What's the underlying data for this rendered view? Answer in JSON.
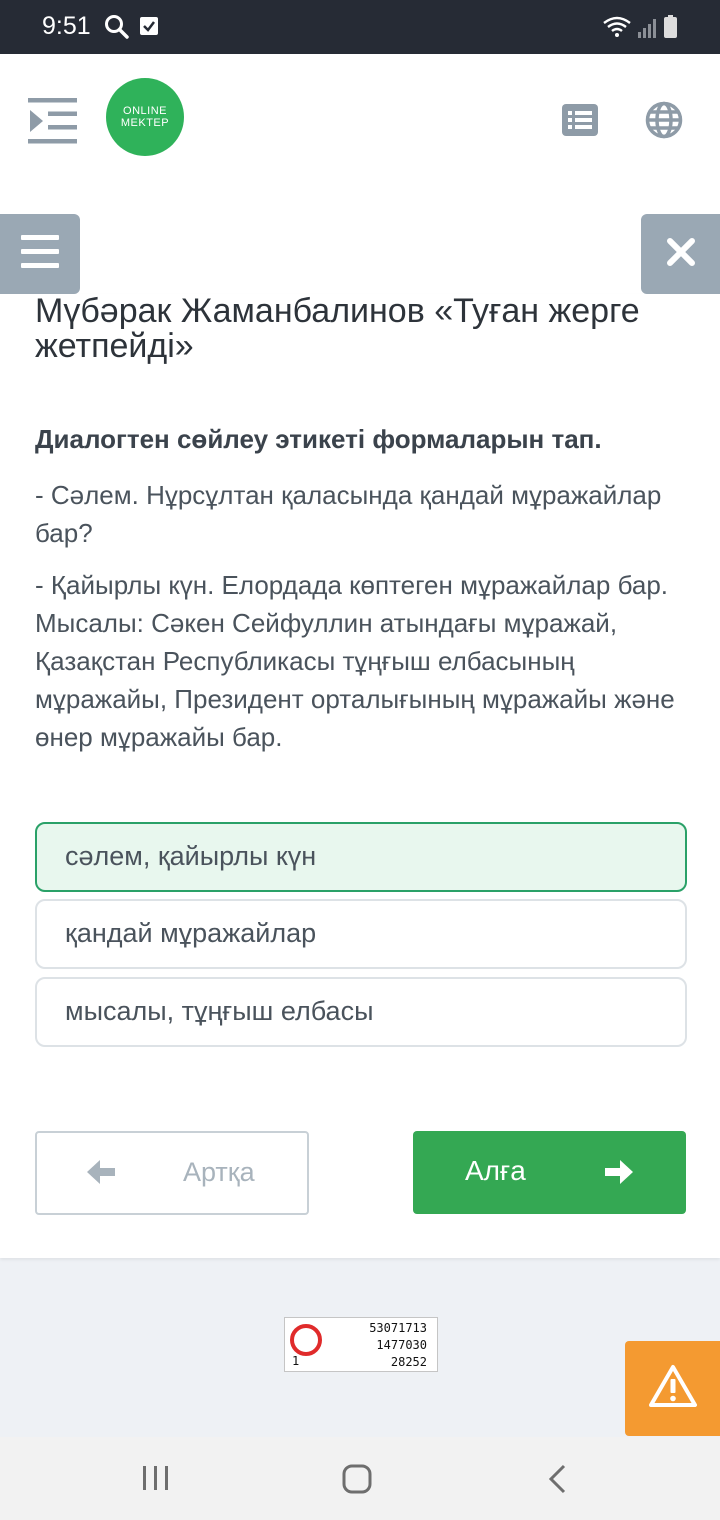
{
  "status_bar": {
    "time": "9:51"
  },
  "header": {
    "logo_line1": "ONLINE",
    "logo_line2": "MEKTEP"
  },
  "lesson": {
    "title": "Мүбәрак Жаманбалинов «Туған жерге жетпейді»",
    "question": "Диалогтен сөйлеу этикеті формаларын тап.",
    "dialog": [
      "- Сәлем. Нұрсұлтан қаласында қандай мұражайлар бар?",
      "- Қайырлы күн. Елордада көптеген мұражайлар бар. Мысалы: Сәкен Сейфуллин атындағы мұражай, Қазақстан Республикасы тұңғыш елбасының мұражайы, Президент орталығының мұражайы және өнер мұражайы бар."
    ]
  },
  "options": [
    {
      "label": "сәлем, қайырлы күн",
      "selected": true
    },
    {
      "label": "қандай мұражайлар",
      "selected": false
    },
    {
      "label": "мысалы, тұңғыш елбасы",
      "selected": false
    }
  ],
  "navigation": {
    "back_label": "Артқа",
    "next_label": "Алға"
  },
  "counter": {
    "corner": "1",
    "v1": "53071713",
    "v2": "1477030",
    "v3": "28252"
  },
  "colors": {
    "accent_green": "#34a853",
    "selected_bg": "#e8f7ee",
    "selected_border": "#2aa168",
    "warning": "#f49a31",
    "side_toggle": "#9aa8b4"
  }
}
